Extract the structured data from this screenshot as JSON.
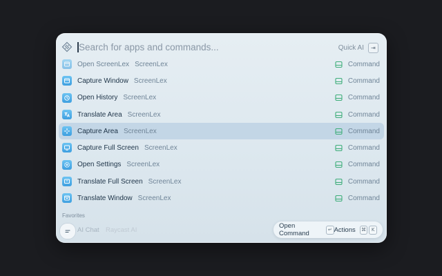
{
  "search": {
    "placeholder": "Search for apps and commands...",
    "quick_ai_label": "Quick AI",
    "quick_ai_key": "⇥"
  },
  "results": [
    {
      "title": "Open ScreenLex",
      "subtitle": "ScreenLex",
      "type": "Command",
      "icon": "app-window-icon",
      "dim": true
    },
    {
      "title": "Capture Window",
      "subtitle": "ScreenLex",
      "type": "Command",
      "icon": "window-icon"
    },
    {
      "title": "Open History",
      "subtitle": "ScreenLex",
      "type": "Command",
      "icon": "history-icon"
    },
    {
      "title": "Translate Area",
      "subtitle": "ScreenLex",
      "type": "Command",
      "icon": "translate-icon"
    },
    {
      "title": "Capture Area",
      "subtitle": "ScreenLex",
      "type": "Command",
      "icon": "crosshair-icon",
      "selected": true
    },
    {
      "title": "Capture Full Screen",
      "subtitle": "ScreenLex",
      "type": "Command",
      "icon": "monitor-icon"
    },
    {
      "title": "Open Settings",
      "subtitle": "ScreenLex",
      "type": "Command",
      "icon": "gear-icon"
    },
    {
      "title": "Translate Full Screen",
      "subtitle": "ScreenLex",
      "type": "Command",
      "icon": "translate-screen-icon"
    },
    {
      "title": "Translate Window",
      "subtitle": "ScreenLex",
      "type": "Command",
      "icon": "translate-window-icon"
    }
  ],
  "favorites": {
    "label": "Favorites",
    "items": [
      {
        "title": "AI Chat",
        "subtitle": "Raycast AI"
      }
    ]
  },
  "action_bar": {
    "primary_label": "Open Command",
    "primary_key": "↵",
    "actions_label": "Actions",
    "actions_key_1": "⌘",
    "actions_key_2": "K"
  },
  "colors": {
    "accent": "#4aa8e6",
    "command_icon": "#3fae7a",
    "selected_row": "#c3d6e6"
  }
}
